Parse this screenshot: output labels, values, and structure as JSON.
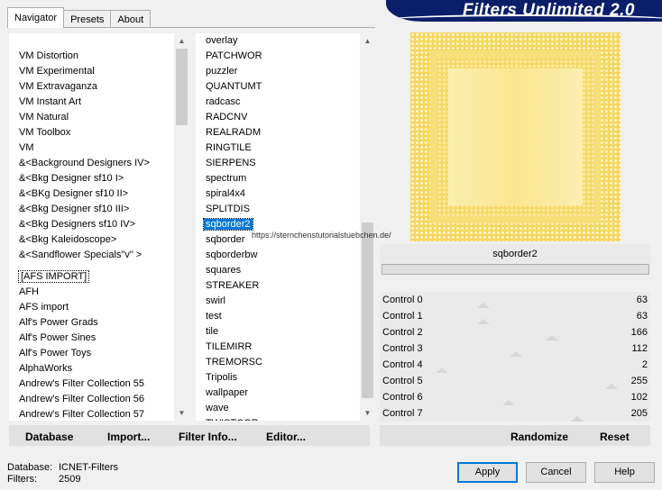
{
  "tabs": [
    "Navigator",
    "Presets",
    "About"
  ],
  "banner_title": "Filters Unlimited 2.0",
  "categories": [
    "VM Distortion",
    "VM Experimental",
    "VM Extravaganza",
    "VM Instant Art",
    "VM Natural",
    "VM Toolbox",
    "VM",
    "&<Background Designers IV>",
    "&<Bkg Designer sf10 I>",
    "&<BKg Designer sf10 II>",
    "&<Bkg Designer sf10 III>",
    "&<Bkg Designers sf10 IV>",
    "&<Bkg Kaleidoscope>",
    "&<Sandflower Specials\"v\" >",
    "",
    "[AFS IMPORT]",
    "AFH",
    "AFS import",
    "Alf's Power Grads",
    "Alf's Power Sines",
    "Alf's Power Toys",
    "AlphaWorks",
    "Andrew's Filter Collection 55",
    "Andrew's Filter Collection 56",
    "Andrew's Filter Collection 57"
  ],
  "filters": [
    "overlay",
    "PATCHWOR",
    "puzzler",
    "QUANTUMT",
    "radcasc",
    "RADCNV",
    "REALRADM",
    "RINGTILE",
    "SIERPENS",
    "spectrum",
    "spiral4x4",
    "SPLITDIS",
    "sqborder2",
    "sqborder",
    "sqborderbw",
    "squares",
    "STREAKER",
    "swirl",
    "test",
    "tile",
    "TILEMIRR",
    "TREMORSC",
    "Tripolis",
    "wallpaper",
    "wave",
    "TWISTCOR"
  ],
  "selected_filter": "sqborder2",
  "filter_name": "sqborder2",
  "controls": [
    {
      "label": "Control 0",
      "value": "63"
    },
    {
      "label": "Control 1",
      "value": "63"
    },
    {
      "label": "Control 2",
      "value": "166"
    },
    {
      "label": "Control 3",
      "value": "112"
    },
    {
      "label": "Control 4",
      "value": "2"
    },
    {
      "label": "Control 5",
      "value": "255"
    },
    {
      "label": "Control 6",
      "value": "102"
    },
    {
      "label": "Control 7",
      "value": "205"
    }
  ],
  "control_levels": [
    0.25,
    0.25,
    0.65,
    0.44,
    0.01,
    1.0,
    0.4,
    0.8
  ],
  "toolbar": {
    "database": "Database",
    "import": "Import...",
    "filter_info": "Filter Info...",
    "editor": "Editor...",
    "randomize": "Randomize",
    "reset": "Reset"
  },
  "info": {
    "database_label": "Database:",
    "database_value": "ICNET-Filters",
    "filters_label": "Filters:",
    "filters_value": "2509"
  },
  "buttons": {
    "apply": "Apply",
    "cancel": "Cancel",
    "help": "Help"
  },
  "watermark": "https://sternchenstutorialstuebchen.de/",
  "colors": {
    "selection": "#0078d7",
    "preview": "#f8e58a",
    "banner": "#0a1e6a"
  }
}
